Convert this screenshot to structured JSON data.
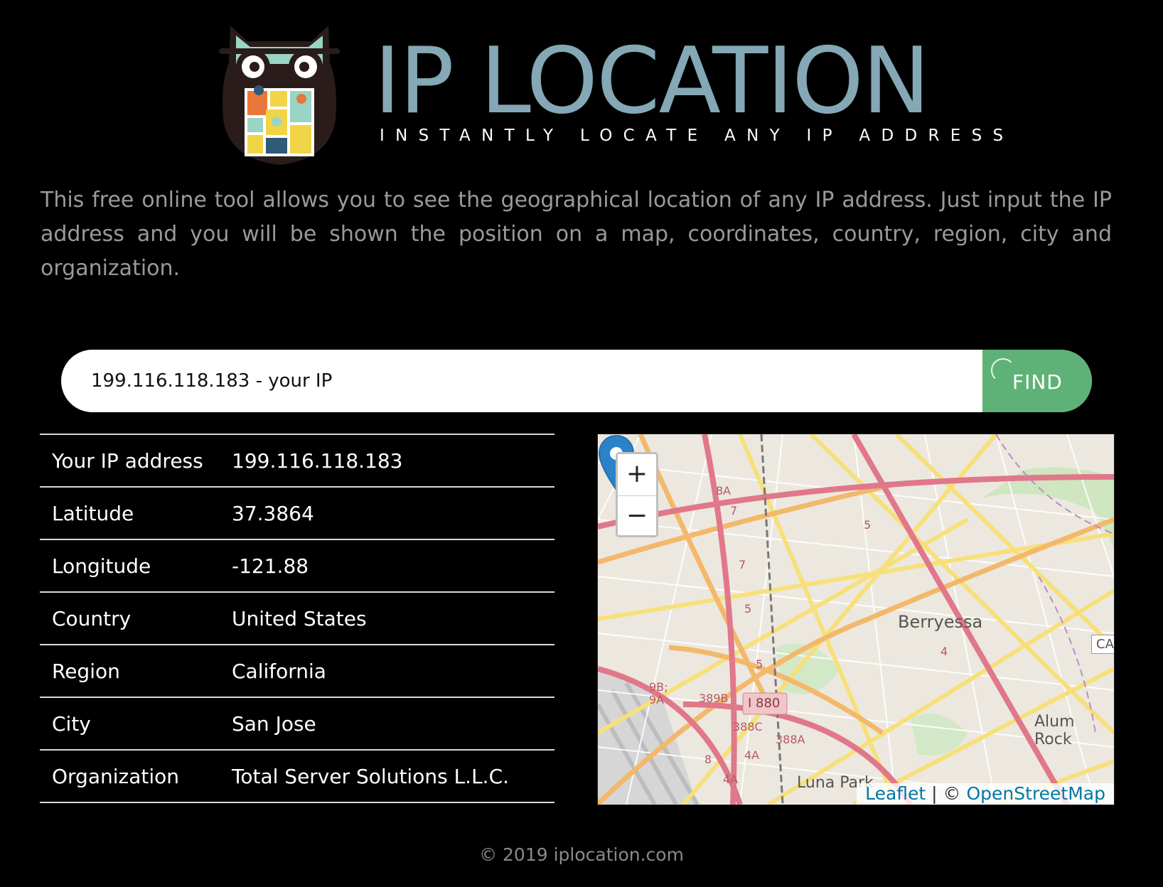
{
  "brand": {
    "title": "IP LOCATION",
    "tagline": "INSTANTLY LOCATE ANY IP ADDRESS",
    "logo_icon": "owl-map-logo-icon"
  },
  "intro": "This free online tool allows you to see the geographical location of any IP address. Just input the IP address and you will be shown the position on a map, coordinates, country, region, city and organization.",
  "search": {
    "value": "199.116.118.183 - your IP",
    "button_label": "FIND"
  },
  "info_rows": [
    {
      "label": "Your IP address",
      "value": "199.116.118.183"
    },
    {
      "label": "Latitude",
      "value": "37.3864"
    },
    {
      "label": "Longitude",
      "value": "-121.88"
    },
    {
      "label": "Country",
      "value": "United States"
    },
    {
      "label": "Region",
      "value": "California"
    },
    {
      "label": "City",
      "value": "San Jose"
    },
    {
      "label": "Organization",
      "value": "Total Server Solutions L.L.C."
    }
  ],
  "map": {
    "zoom_in": "+",
    "zoom_out": "−",
    "place_labels": [
      "Berryessa",
      "Alum Rock",
      "Luna Park",
      "CA",
      "I 880",
      "389B",
      "388C",
      "388A",
      "9B;",
      "9A",
      "8A",
      "4A",
      "4A",
      "5",
      "5",
      "5",
      "4",
      "7",
      "7",
      "8"
    ],
    "attribution": {
      "leaflet": "Leaflet",
      "separator": " | © ",
      "osm": "OpenStreetMap"
    },
    "marker_icon": "map-marker-icon"
  },
  "footer": "© 2019 iplocation.com",
  "colors": {
    "background": "#000000",
    "brand_title": "#84a8b5",
    "find_button": "#5fb277",
    "intro_text": "#9a9a9a"
  }
}
